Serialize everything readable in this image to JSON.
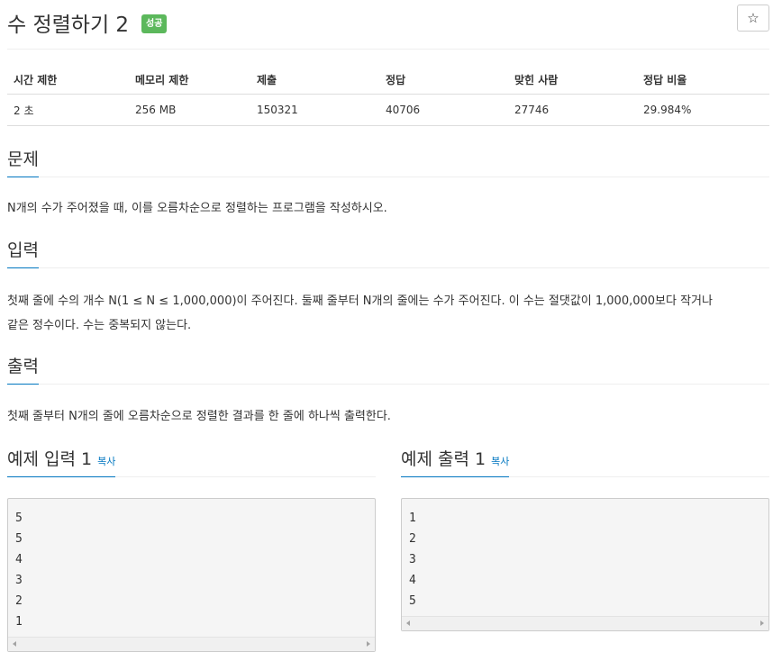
{
  "problem": {
    "title": "수 정렬하기 2",
    "badge": "성공",
    "star_icon": "☆"
  },
  "stats": {
    "headers": [
      "시간 제한",
      "메모리 제한",
      "제출",
      "정답",
      "맞힌 사람",
      "정답 비율"
    ],
    "values": [
      "2 초",
      "256 MB",
      "150321",
      "40706",
      "27746",
      "29.984%"
    ]
  },
  "sections": {
    "description": {
      "title": "문제",
      "text": "N개의 수가 주어졌을 때, 이를 오름차순으로 정렬하는 프로그램을 작성하시오."
    },
    "input": {
      "title": "입력",
      "line1": "첫째 줄에 수의 개수 N(1 ≤ N ≤ 1,000,000)이 주어진다. 둘째 줄부터 N개의 줄에는 수가 주어진다. 이 수는 절댓값이 1,000,000보다 작거나",
      "line2": "같은 정수이다. 수는 중복되지 않는다."
    },
    "output": {
      "title": "출력",
      "text": "첫째 줄부터 N개의 줄에 오름차순으로 정렬한 결과를 한 줄에 하나씩 출력한다."
    }
  },
  "samples": {
    "input": {
      "title": "예제 입력 1",
      "copy": "복사",
      "lines": [
        "5",
        "5",
        "4",
        "3",
        "2",
        "1"
      ]
    },
    "output": {
      "title": "예제 출력 1",
      "copy": "복사",
      "lines": [
        "1",
        "2",
        "3",
        "4",
        "5"
      ]
    }
  }
}
